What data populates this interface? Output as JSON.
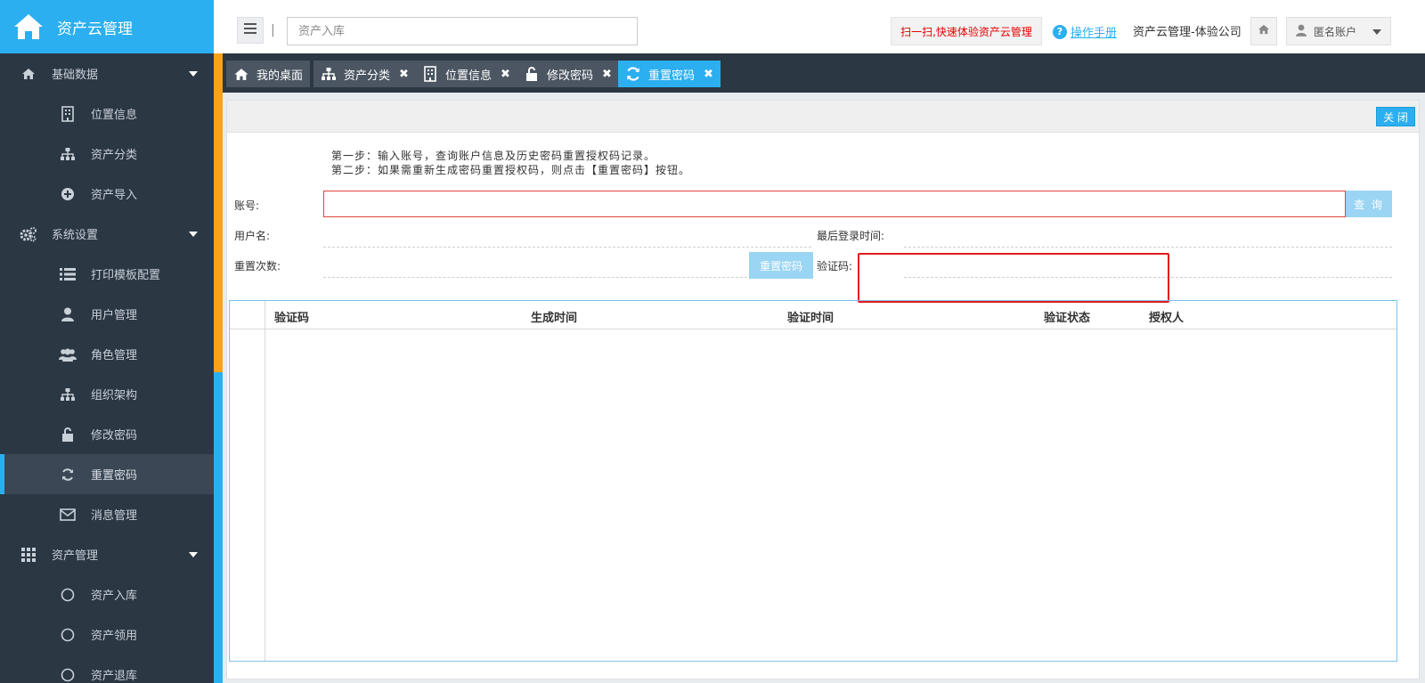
{
  "app": {
    "title": "资产云管理"
  },
  "sidebar": {
    "groups": [
      {
        "label": "基础数据",
        "icon": "home-icon",
        "items": [
          {
            "label": "位置信息",
            "icon": "building-icon"
          },
          {
            "label": "资产分类",
            "icon": "sitemap-icon"
          },
          {
            "label": "资产导入",
            "icon": "plus-circle-icon"
          }
        ]
      },
      {
        "label": "系统设置",
        "icon": "gears-icon",
        "items": [
          {
            "label": "打印模板配置",
            "icon": "list-icon"
          },
          {
            "label": "用户管理",
            "icon": "user-icon"
          },
          {
            "label": "角色管理",
            "icon": "users-icon"
          },
          {
            "label": "组织架构",
            "icon": "sitemap-icon"
          },
          {
            "label": "修改密码",
            "icon": "unlock-icon"
          },
          {
            "label": "重置密码",
            "icon": "refresh-icon",
            "active": true
          },
          {
            "label": "消息管理",
            "icon": "envelope-icon"
          }
        ]
      },
      {
        "label": "资产管理",
        "icon": "grid-icon",
        "items": [
          {
            "label": "资产入库",
            "icon": "circle-icon"
          },
          {
            "label": "资产领用",
            "icon": "circle-icon"
          },
          {
            "label": "资产退库",
            "icon": "circle-icon"
          }
        ]
      }
    ]
  },
  "header": {
    "search_placeholder": "资产入库",
    "separator": "|",
    "promo": "扫一扫,快速体验资产云管理",
    "help_link": "操作手册",
    "company": "资产云管理-体验公司",
    "user": "匿名账户"
  },
  "tabs": [
    {
      "label": "我的桌面",
      "icon": "home-icon",
      "closable": false
    },
    {
      "label": "资产分类",
      "icon": "sitemap-icon",
      "closable": true
    },
    {
      "label": "位置信息",
      "icon": "building-icon",
      "closable": true
    },
    {
      "label": "修改密码",
      "icon": "unlock-icon",
      "closable": true
    },
    {
      "label": "重置密码",
      "icon": "refresh-icon",
      "closable": true,
      "active": true
    }
  ],
  "panel": {
    "close_label": "关 闭",
    "step1": "第一步：输入账号，查询账户信息及历史密码重置授权码记录。",
    "step2": "第二步：如果需重新生成密码重置授权码，则点击【重置密码】按钮。",
    "account_label": "账号:",
    "account_value": "",
    "query_label": "查 询",
    "username_label": "用户名:",
    "last_login_label": "最后登录时间:",
    "reset_count_label": "重置次数:",
    "reset_button": "重置密码",
    "verify_label": "验证码:"
  },
  "grid": {
    "columns": [
      "验证码",
      "生成时间",
      "验证时间",
      "验证状态",
      "授权人"
    ],
    "rows": []
  },
  "colors": {
    "accent": "#2baff0",
    "sidebar": "#2c3744",
    "highlight": "#e21b1b",
    "promo_text": "#e60000"
  }
}
